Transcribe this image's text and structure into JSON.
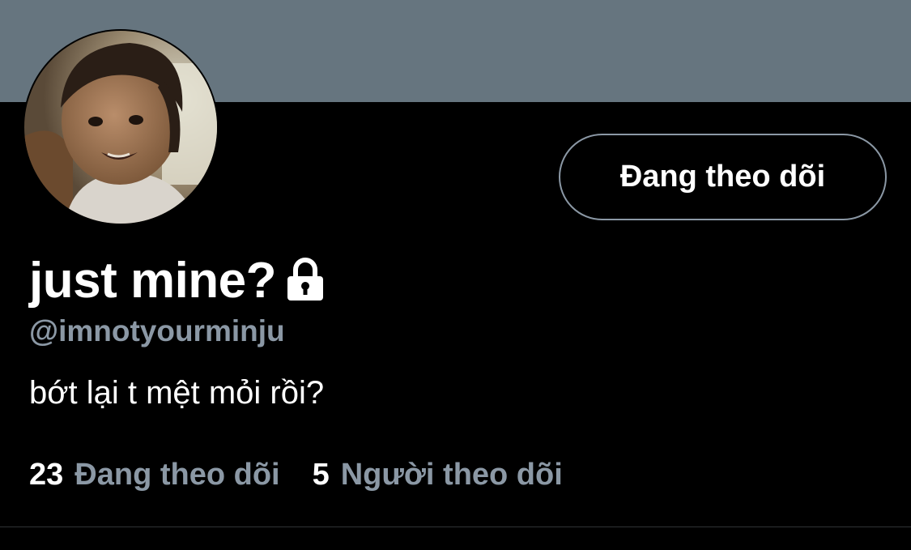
{
  "profile": {
    "display_name": "just mine?",
    "handle": "@imnotyourminju",
    "bio": "bớt lại t mệt mỏi rồi?",
    "protected_icon": "lock-icon",
    "follow_button_label": "Đang theo dõi",
    "stats": {
      "following_count": "23",
      "following_label": "Đang theo dõi",
      "followers_count": "5",
      "followers_label": "Người theo dõi"
    }
  },
  "colors": {
    "banner": "#66757f",
    "background": "#000000",
    "secondary_text": "#8b98a5",
    "primary_text": "#ffffff"
  }
}
